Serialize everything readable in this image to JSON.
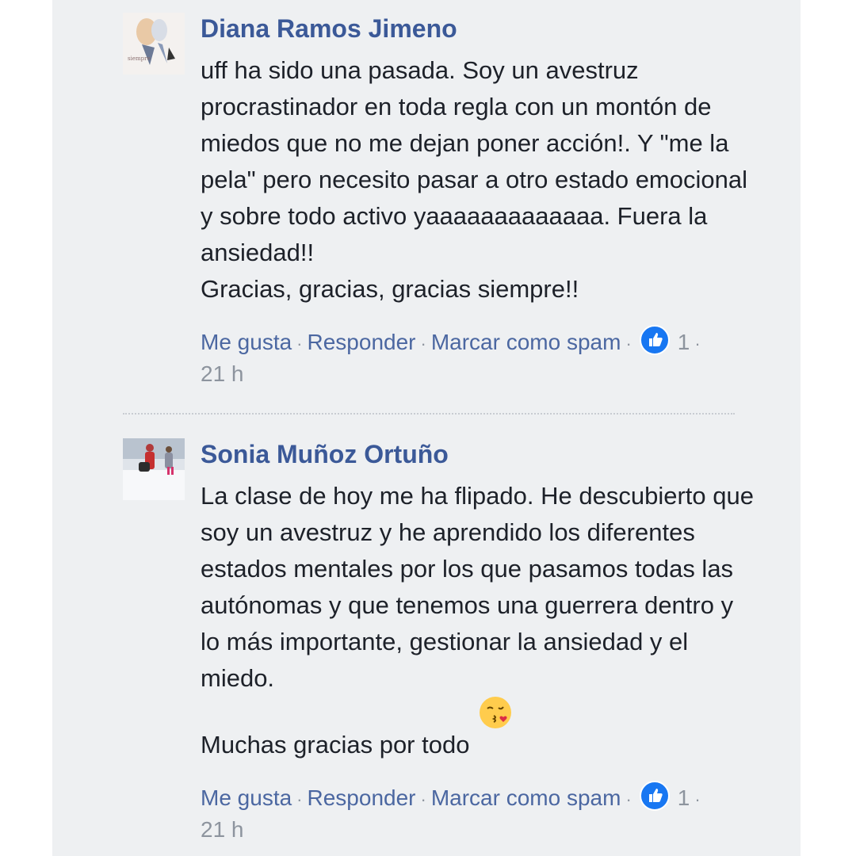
{
  "comments": [
    {
      "author": "Diana Ramos Jimeno",
      "text": "uff ha sido una pasada. Soy un avestruz procrastinador en toda regla con un montón de miedos que no me dejan poner acción!. Y \"me la pela\" pero necesito pasar a otro estado emocional y sobre todo activo yaaaaaaaaaaaaa. Fuera la ansiedad!!\nGracias, gracias, gracias siempre!!",
      "like_label": "Me gusta",
      "reply_label": "Responder",
      "spam_label": "Marcar como spam",
      "reaction_count": "1",
      "time": "21 h",
      "avatar_icon": "illustration-avatar"
    },
    {
      "author": "Sonia Muñoz Ortuño",
      "text": "La clase de hoy me ha flipado. He descubierto que soy un avestruz y he aprendido los diferentes estados mentales por los que pasamos todas las autónomas y que tenemos una guerrera dentro y lo más importante, gestionar la ansiedad y el miedo.\nMuchas gracias por todo",
      "emoji": "kissing-face-emoji",
      "like_label": "Me gusta",
      "reply_label": "Responder",
      "spam_label": "Marcar como spam",
      "reaction_count": "1",
      "time": "21 h",
      "avatar_icon": "snow-photo-avatar"
    }
  ],
  "colors": {
    "author": "#3b5998",
    "link": "#4b67a1",
    "meta": "#8d949e",
    "like": "#1877f2"
  }
}
